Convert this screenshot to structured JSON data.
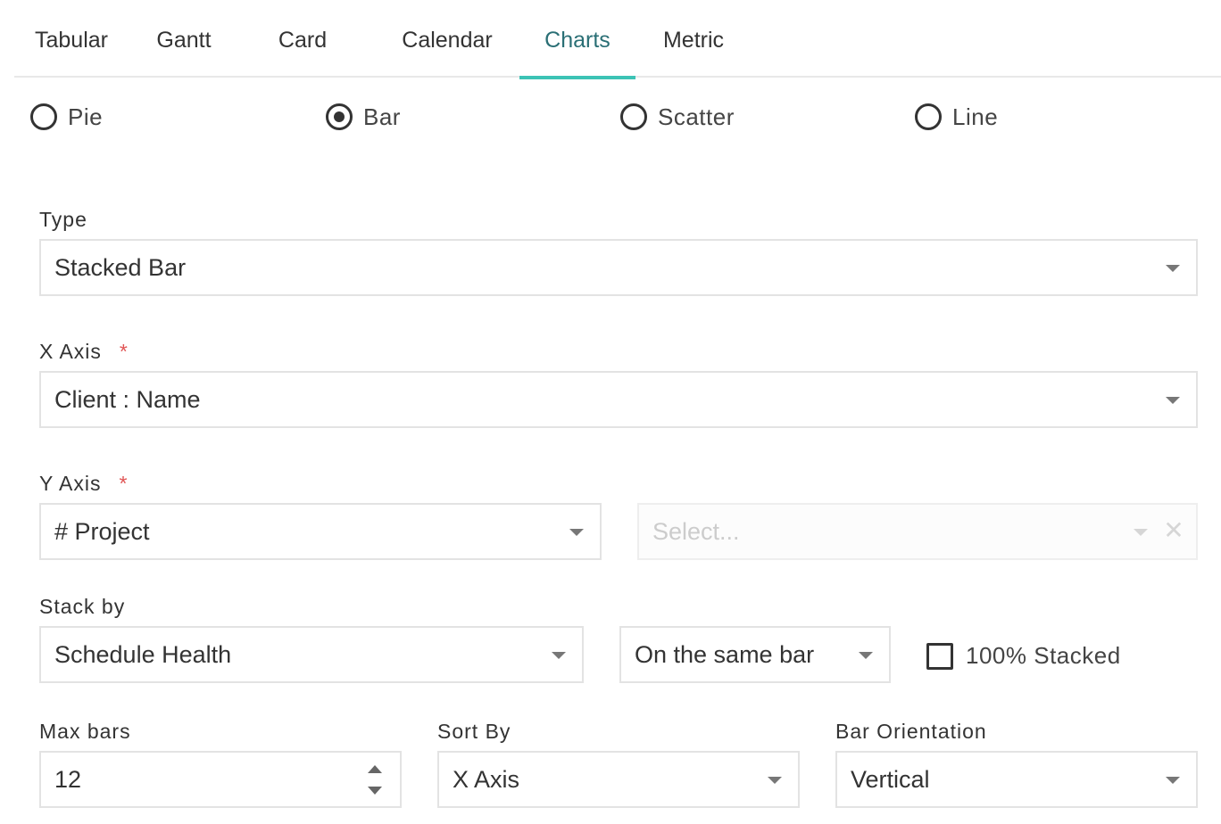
{
  "tabs": [
    {
      "label": "Tabular",
      "active": false
    },
    {
      "label": "Gantt",
      "active": false
    },
    {
      "label": "Card",
      "active": false
    },
    {
      "label": "Calendar",
      "active": false
    },
    {
      "label": "Charts",
      "active": true
    },
    {
      "label": "Metric",
      "active": false
    }
  ],
  "chart_kinds": [
    {
      "label": "Pie",
      "checked": false
    },
    {
      "label": "Bar",
      "checked": true
    },
    {
      "label": "Scatter",
      "checked": false
    },
    {
      "label": "Line",
      "checked": false
    }
  ],
  "type_field": {
    "label": "Type",
    "value": "Stacked Bar"
  },
  "x_axis": {
    "label": "X Axis",
    "required_mark": "*",
    "value": "Client : Name"
  },
  "y_axis": {
    "label": "Y Axis",
    "required_mark": "*",
    "value": "# Project",
    "secondary_placeholder": "Select...",
    "clear_glyph": "✕"
  },
  "stack_by": {
    "label": "Stack by",
    "value": "Schedule Health",
    "mode": "On the same bar",
    "percent_stacked_label": "100% Stacked",
    "percent_stacked_checked": false
  },
  "max_bars": {
    "label": "Max bars",
    "value": "12"
  },
  "sort_by": {
    "label": "Sort By",
    "value": "X Axis"
  },
  "bar_orientation": {
    "label": "Bar Orientation",
    "value": "Vertical"
  },
  "colors": {
    "accent": "#3cc3b5",
    "required": "#e05555",
    "border": "#e3e3e3"
  }
}
